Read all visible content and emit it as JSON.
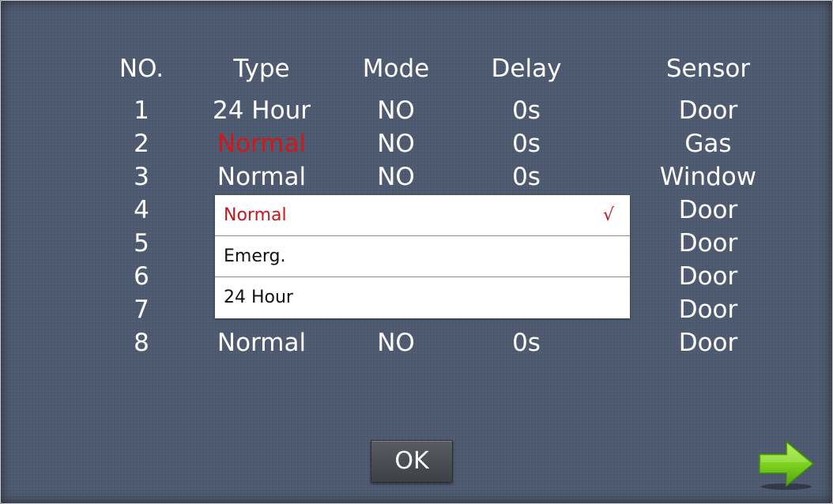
{
  "table": {
    "headers": {
      "no": "NO.",
      "type": "Type",
      "mode": "Mode",
      "delay": "Delay",
      "sensor": "Sensor"
    },
    "rows": [
      {
        "no": "1",
        "type": "24 Hour",
        "mode": "NO",
        "delay": "0s",
        "sensor": "Door"
      },
      {
        "no": "2",
        "type": "Normal",
        "mode": "NO",
        "delay": "0s",
        "sensor": "Gas"
      },
      {
        "no": "3",
        "type": "Normal",
        "mode": "NO",
        "delay": "0s",
        "sensor": "Window"
      },
      {
        "no": "4",
        "type": "",
        "mode": "",
        "delay": "",
        "sensor": "Door"
      },
      {
        "no": "5",
        "type": "",
        "mode": "",
        "delay": "",
        "sensor": "Door"
      },
      {
        "no": "6",
        "type": "",
        "mode": "",
        "delay": "",
        "sensor": "Door"
      },
      {
        "no": "7",
        "type": "",
        "mode": "",
        "delay": "",
        "sensor": "Door"
      },
      {
        "no": "8",
        "type": "Normal",
        "mode": "NO",
        "delay": "0s",
        "sensor": "Door"
      }
    ],
    "selected_row": 2
  },
  "dropdown": {
    "options": [
      {
        "label": "Normal",
        "selected": true
      },
      {
        "label": "Emerg.",
        "selected": false
      },
      {
        "label": "24 Hour",
        "selected": false
      }
    ],
    "check_mark": "√"
  },
  "buttons": {
    "ok_label": "OK",
    "next_icon": "arrow-right-icon"
  },
  "colors": {
    "background": "#4e5a70",
    "selected_text": "#d4161b",
    "arrow_green": "#7fd31f"
  }
}
